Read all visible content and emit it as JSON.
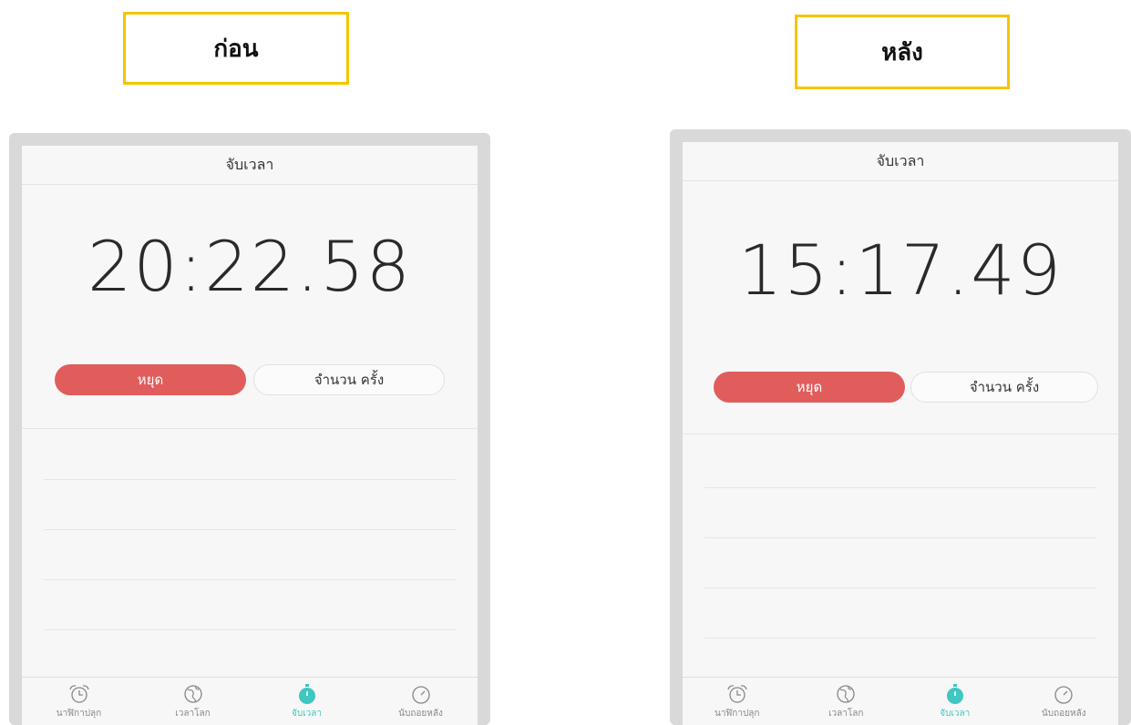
{
  "labels": {
    "before": "ก่อน",
    "after": "หลัง"
  },
  "colors": {
    "accent": "#3fc7c1",
    "stop": "#e05d5c",
    "highlight_border": "#f5c400"
  },
  "before": {
    "header_title": "จับเวลา",
    "time": "20:22.58",
    "stop_label": "หยุด",
    "lap_label": "จำนวน ครั้ง",
    "tabs": [
      {
        "label": "นาฬิกาปลุก",
        "icon": "alarm-clock-icon"
      },
      {
        "label": "เวลาโลก",
        "icon": "globe-icon"
      },
      {
        "label": "จับเวลา",
        "icon": "stopwatch-icon",
        "active": true
      },
      {
        "label": "นับถอยหลัง",
        "icon": "timer-icon"
      }
    ]
  },
  "after": {
    "header_title": "จับเวลา",
    "time": "15:17.49",
    "stop_label": "หยุด",
    "lap_label": "จำนวน ครั้ง",
    "tabs": [
      {
        "label": "นาฬิกาปลุก",
        "icon": "alarm-clock-icon"
      },
      {
        "label": "เวลาโลก",
        "icon": "globe-icon"
      },
      {
        "label": "จับเวลา",
        "icon": "stopwatch-icon",
        "active": true
      },
      {
        "label": "นับถอยหลัง",
        "icon": "timer-icon"
      }
    ]
  }
}
